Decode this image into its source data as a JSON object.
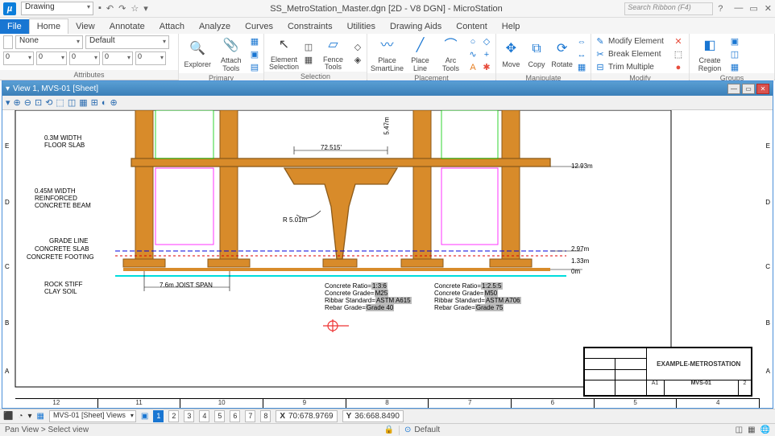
{
  "app": {
    "title": "SS_MetroStation_Master.dgn [2D - V8 DGN] - MicroStation",
    "workflow": "Drawing",
    "search_placeholder": "Search Ribbon (F4)"
  },
  "tabs": {
    "file": "File",
    "home": "Home",
    "view": "View",
    "annotate": "Annotate",
    "attach": "Attach",
    "analyze": "Analyze",
    "curves": "Curves",
    "constraints": "Constraints",
    "utilities": "Utilities",
    "drawingaids": "Drawing Aids",
    "content": "Content",
    "help": "Help"
  },
  "attributes": {
    "layer": "None",
    "template": "Default",
    "linewt": "0",
    "linestyle": "0",
    "color": "0",
    "class": "0",
    "fill": "0",
    "group": "Attributes"
  },
  "ribbon": {
    "primary": {
      "label": "Primary",
      "explorer": "Explorer",
      "attach": "Attach Tools"
    },
    "selection": {
      "label": "Selection",
      "element": "Element Selection",
      "fence": "Fence Tools"
    },
    "placement": {
      "label": "Placement",
      "smartline": "Place SmartLine",
      "line": "Place Line",
      "arc": "Arc Tools"
    },
    "manipulate": {
      "label": "Manipulate",
      "move": "Move",
      "copy": "Copy",
      "rotate": "Rotate"
    },
    "modify": {
      "label": "Modify",
      "modifyel": "Modify Element",
      "breakel": "Break Element",
      "trim": "Trim Multiple"
    },
    "groups": {
      "label": "Groups",
      "region": "Create Region"
    }
  },
  "view": {
    "title": "View 1, MVS-01 [Sheet]"
  },
  "drawing": {
    "floor_slab": "0.3M WIDTH\nFLOOR SLAB",
    "beam": "0.45M WIDTH\nREINFORCED\nCONCRETE BEAM",
    "grade": "GRADE LINE",
    "slab": "CONCRETE SLAB",
    "footing": "CONCRETE FOOTING",
    "soil": "ROCK STIFF\nCLAY SOIL",
    "joist": "7.6m JOIST SPAN",
    "span72": "72.515'",
    "h547": "5.47m",
    "r501": "R 5.01m",
    "d1293": "12.93m",
    "d297": "2.97m",
    "d133": "1.33m",
    "d0": "0m",
    "notes1": {
      "ratio": "Concrete Ratio=",
      "ratio_v": "1:3:6",
      "grade": "Concrete Grade=",
      "grade_v": "M25",
      "std": "Ribbar Standard=",
      "std_v": "ASTM A615",
      "rebar": "Rebar Grade=",
      "rebar_v": "Grade 40"
    },
    "notes2": {
      "ratio": "Concrete Ratio=",
      "ratio_v": "1:2.5:5",
      "grade": "Concrete Grade=",
      "grade_v": "M50",
      "std": "Ribbar Standard=",
      "std_v": "ASTM A706",
      "rebar": "Rebar Grade=",
      "rebar_v": "Grade 75"
    },
    "tb": {
      "project": "EXAMPLE-METROSTATION",
      "sheet": "MVS-01",
      "size": "A1",
      "rev": "2"
    },
    "ruler": [
      "12",
      "11",
      "10",
      "9",
      "8",
      "7",
      "6",
      "5",
      "4"
    ],
    "rside": [
      "E",
      "D",
      "C",
      "B",
      "A"
    ],
    "lside": [
      "E",
      "D",
      "C",
      "B",
      "A"
    ]
  },
  "status": {
    "views_dd": "MVS-01 [Sheet] Views",
    "x": "70:678.9769",
    "y": "36:668.8490",
    "prompt": "Pan View > Select view",
    "level": "Default"
  }
}
